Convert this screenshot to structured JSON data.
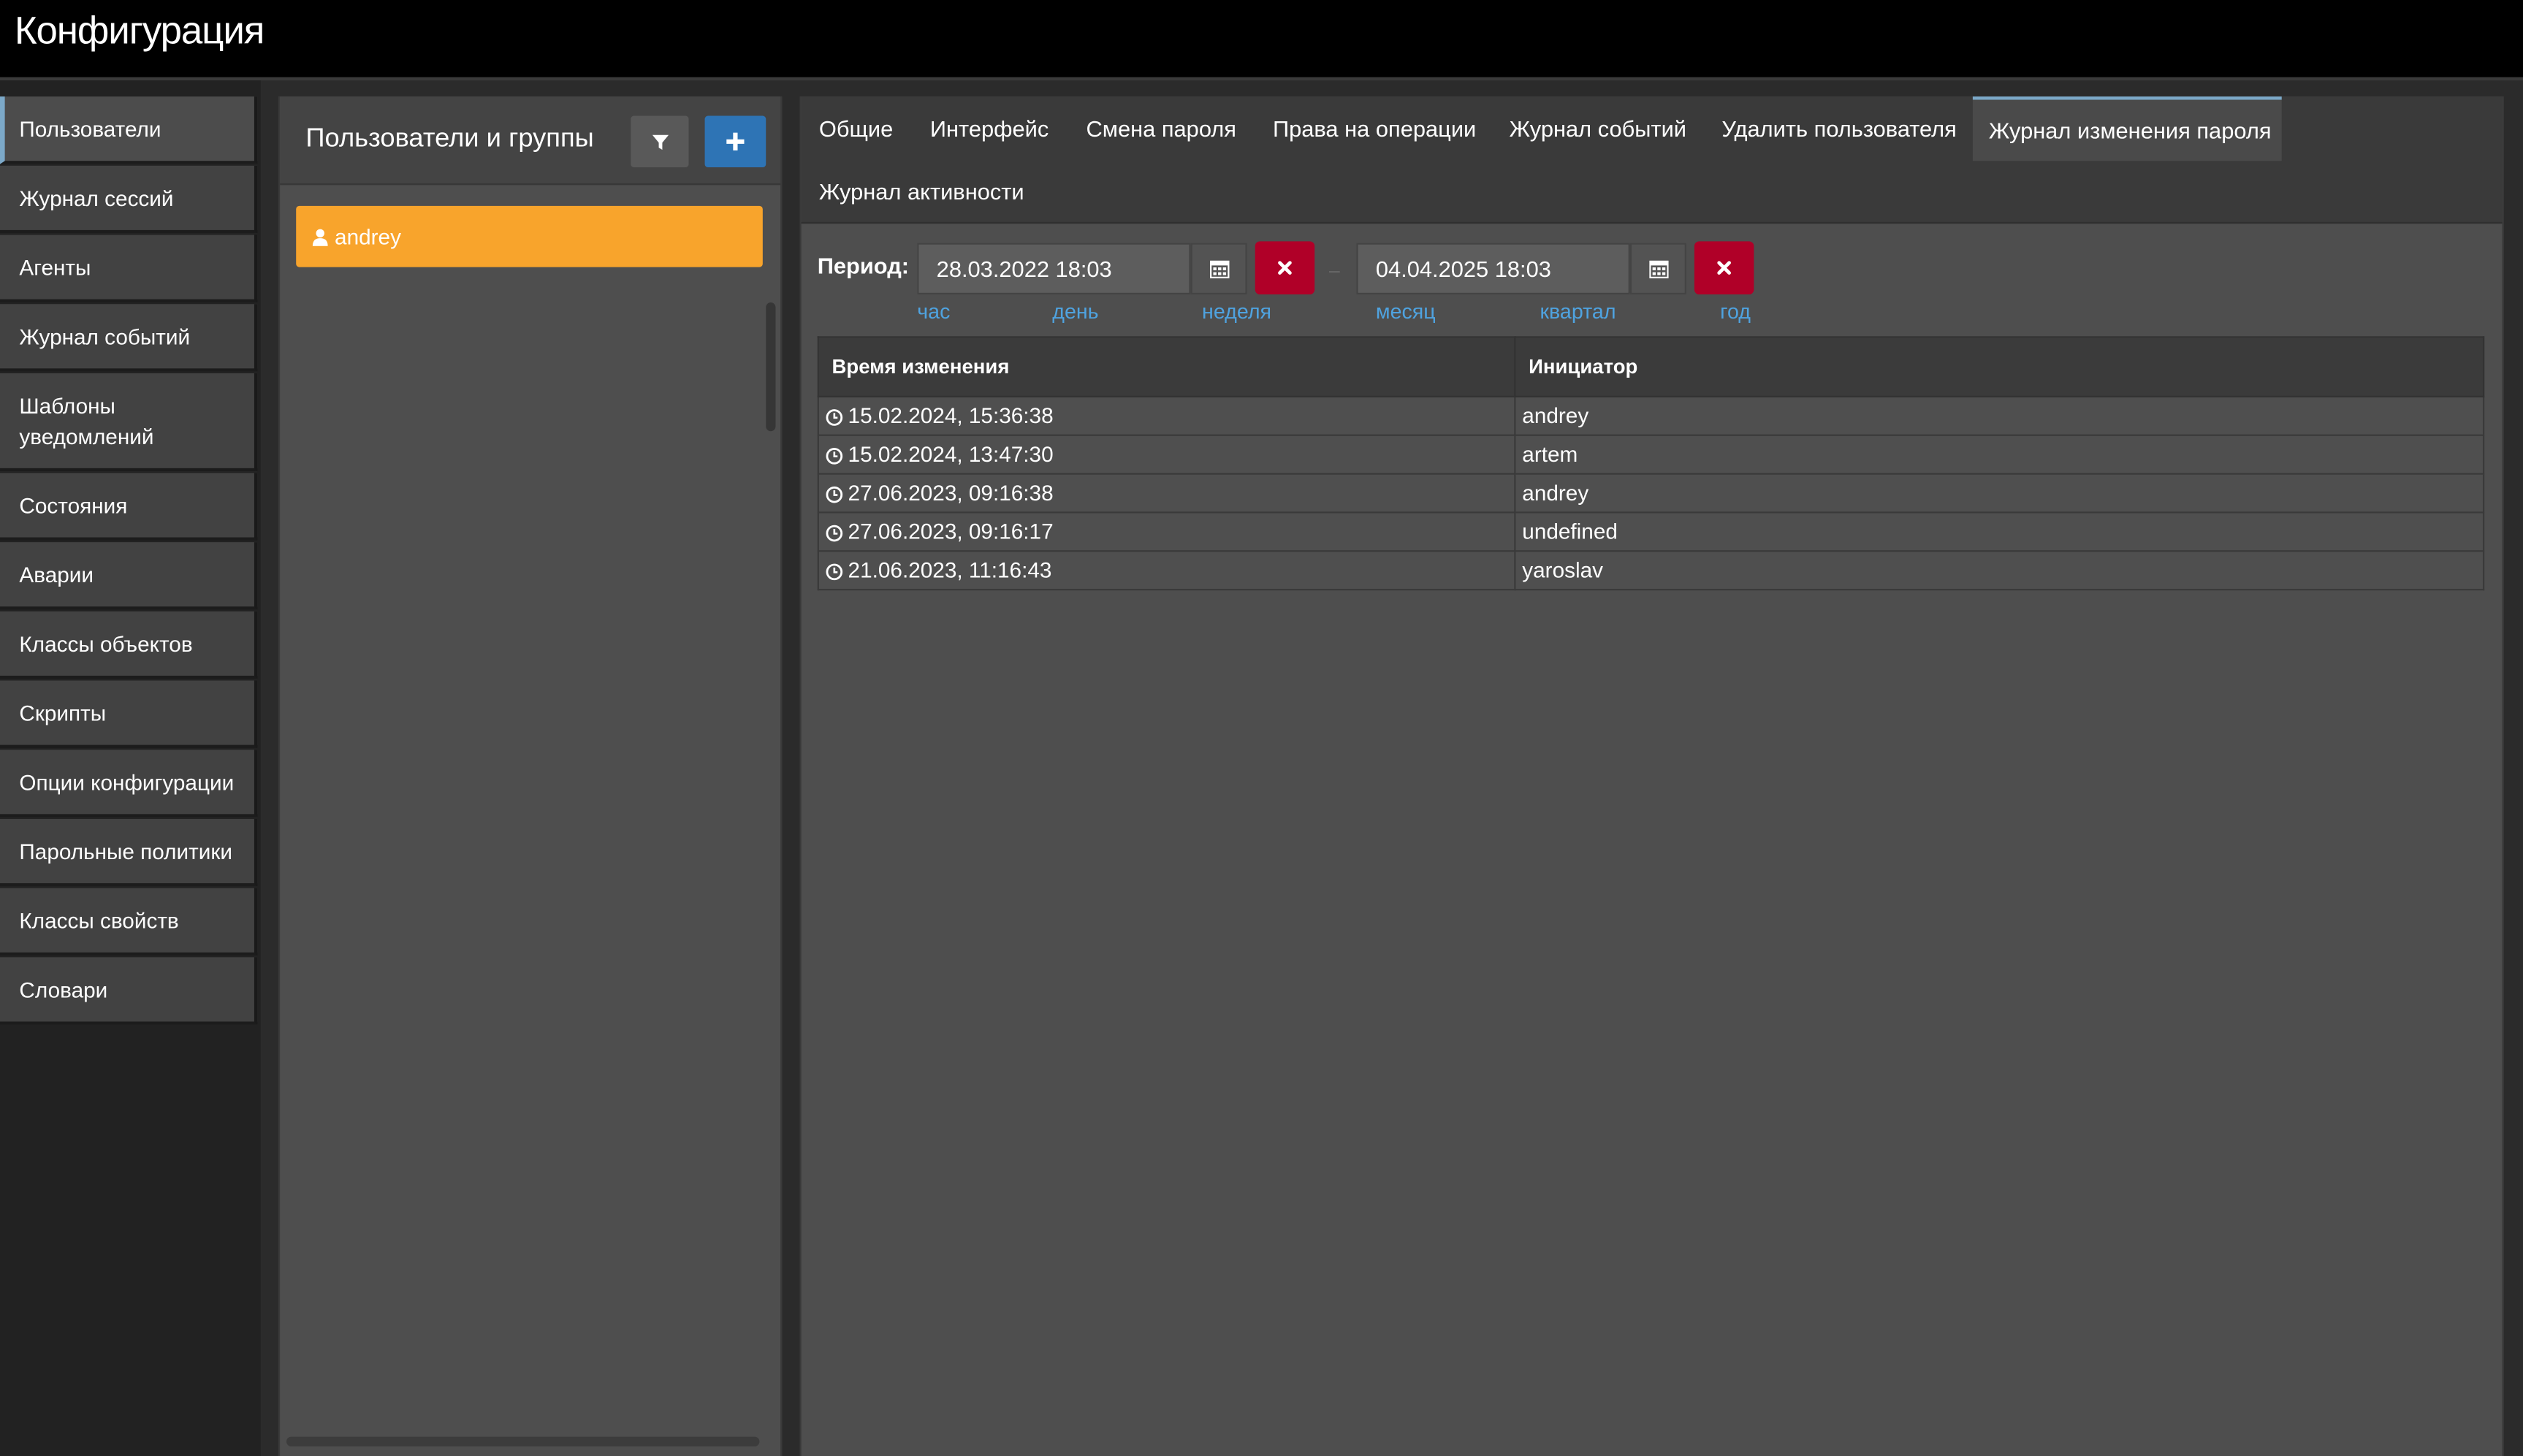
{
  "app": {
    "title": "Конфигурация"
  },
  "sidebar": {
    "items": [
      {
        "label": "Пользователи",
        "active": true
      },
      {
        "label": "Журнал сессий"
      },
      {
        "label": "Агенты"
      },
      {
        "label": "Журнал событий"
      },
      {
        "label": "Шаблоны уведомлений"
      },
      {
        "label": "Состояния"
      },
      {
        "label": "Аварии"
      },
      {
        "label": "Классы объектов"
      },
      {
        "label": "Скрипты"
      },
      {
        "label": "Опции конфигурации"
      },
      {
        "label": "Парольные политики"
      },
      {
        "label": "Классы свойств"
      },
      {
        "label": "Словари"
      }
    ]
  },
  "users_panel": {
    "title": "Пользователи и группы",
    "filter_icon": "filter-icon",
    "add_icon": "plus-icon",
    "users": [
      {
        "name": "andrey",
        "icon": "user-icon",
        "color": "#f8a42c"
      }
    ]
  },
  "tabs": [
    {
      "label": "Общие"
    },
    {
      "label": "Интерфейс"
    },
    {
      "label": "Смена пароля"
    },
    {
      "label": "Права на операции"
    },
    {
      "label": "Журнал событий"
    },
    {
      "label": "Удалить пользователя"
    },
    {
      "label": "Журнал изменения пароля",
      "active": true
    },
    {
      "label": "Журнал активности"
    }
  ],
  "period": {
    "label": "Период:",
    "from": "28.03.2022 18:03",
    "to": "04.04.2025 18:03",
    "separator": "–",
    "calendar_icon": "calendar-icon",
    "clear_icon": "close-icon",
    "quick_ranges": [
      "час",
      "день",
      "неделя",
      "месяц",
      "квартал",
      "год"
    ]
  },
  "table": {
    "columns": [
      "Время изменения",
      "Инициатор"
    ],
    "rows": [
      [
        "15.02.2024, 15:36:38",
        "andrey"
      ],
      [
        "15.02.2024, 13:47:30",
        "artem"
      ],
      [
        "27.06.2023, 09:16:38",
        "andrey"
      ],
      [
        "27.06.2023, 09:16:17",
        "undefined"
      ],
      [
        "21.06.2023, 11:16:43",
        "yaroslav"
      ]
    ]
  },
  "colors": {
    "accent_blue": "#2e74b5",
    "user_orange": "#f8a42c",
    "danger_red": "#b00028",
    "link_blue": "#4fa3e0"
  }
}
